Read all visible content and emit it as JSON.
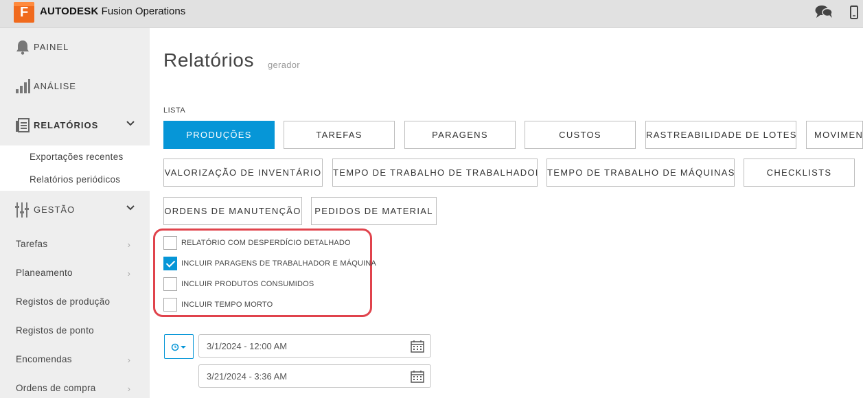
{
  "app": {
    "logo_letter": "F",
    "brand_bold": "AUTODESK",
    "brand_rest": "Fusion Operations"
  },
  "sidebar": {
    "painel": "PAINEL",
    "analise": "ANÁLISE",
    "relatorios": "RELATÓRIOS",
    "relatorios_sub": [
      "Exportações recentes",
      "Relatórios periódicos"
    ],
    "gestao": "GESTÃO",
    "items": [
      {
        "label": "Tarefas",
        "has_arrow": true
      },
      {
        "label": "Planeamento",
        "has_arrow": true
      },
      {
        "label": "Registos de produção",
        "has_arrow": false
      },
      {
        "label": "Registos de ponto",
        "has_arrow": false
      },
      {
        "label": "Encomendas",
        "has_arrow": true
      },
      {
        "label": "Ordens de compra",
        "has_arrow": true
      }
    ]
  },
  "main": {
    "title": "Relatórios",
    "subtitle": "gerador",
    "list_label": "LISTA",
    "tabs": [
      "PRODUÇÕES",
      "TAREFAS",
      "PARAGENS",
      "CUSTOS",
      "RASTREABILIDADE DE LOTES",
      "MOVIMENTOS",
      "VALORIZAÇÃO DE INVENTÁRIO",
      "TEMPO DE TRABALHO DE TRABALHADOR",
      "TEMPO DE TRABALHO DE MÁQUINAS",
      "CHECKLISTS",
      "ORDENS DE MANUTENÇÃO",
      "PEDIDOS DE MATERIAL"
    ],
    "active_tab": "PRODUÇÕES",
    "options": [
      {
        "label": "RELATÓRIO COM DESPERDÍCIO DETALHADO",
        "checked": false
      },
      {
        "label": "INCLUIR PARAGENS DE TRABALHADOR E MÁQUINA",
        "checked": true
      },
      {
        "label": "INCLUIR PRODUTOS CONSUMIDOS",
        "checked": false
      },
      {
        "label": "INCLUIR TEMPO MORTO",
        "checked": false
      }
    ],
    "date_from": "3/1/2024 - 12:00 AM",
    "date_to": "3/21/2024 - 3:36 AM"
  },
  "colors": {
    "accent": "#0696d7",
    "highlight": "#e0434c",
    "brand_orange": "#f06a1d"
  }
}
